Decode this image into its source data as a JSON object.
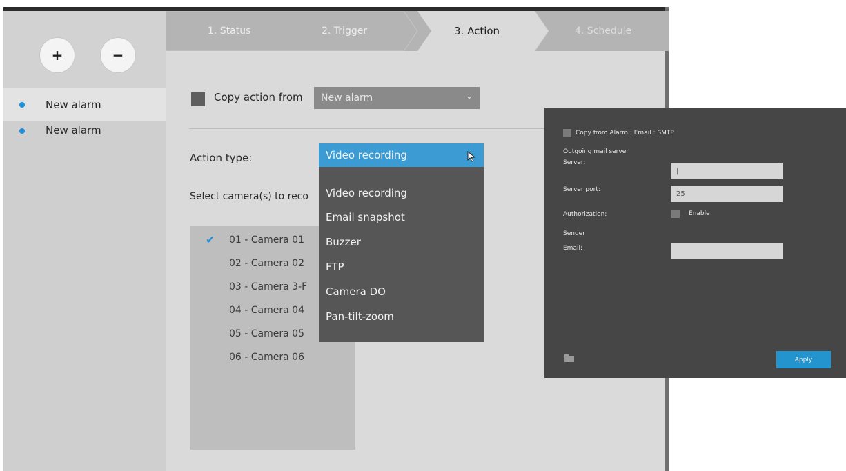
{
  "sidebar": {
    "add_label": "+",
    "remove_label": "−",
    "items": [
      {
        "label": "New alarm"
      },
      {
        "label": "New alarm"
      }
    ]
  },
  "steps": [
    {
      "label": "1. Status"
    },
    {
      "label": "2. Trigger"
    },
    {
      "label": "3. Action"
    },
    {
      "label": "4. Schedule"
    }
  ],
  "form": {
    "copy_label": "Copy action from",
    "copy_value": "New alarm",
    "action_type_label": "Action type:",
    "select_camera_label": "Select camera(s) to reco"
  },
  "dropdown": {
    "selected": "Video recording",
    "options": [
      {
        "label": "Video recording"
      },
      {
        "label": "Email snapshot"
      },
      {
        "label": "Buzzer"
      },
      {
        "label": "FTP"
      },
      {
        "label": "Camera DO"
      },
      {
        "label": "Pan-tilt-zoom"
      }
    ]
  },
  "cameras": [
    {
      "label": "01 - Camera 01"
    },
    {
      "label": "02 - Camera 02"
    },
    {
      "label": "03 - Camera 3-F"
    },
    {
      "label": "04 - Camera 04"
    },
    {
      "label": "05 - Camera 05"
    },
    {
      "label": "06 - Camera 06"
    }
  ],
  "email_panel": {
    "copy_label": "Copy from Alarm : Email : SMTP",
    "section_server": "Outgoing mail server",
    "server_label": "Server:",
    "server_value": "|",
    "port_label": "Server port:",
    "port_value": "25",
    "auth_label": "Authorization:",
    "auth_enable": "Enable",
    "section_sender": "Sender",
    "email_label": "Email:",
    "email_value": "",
    "apply_label": "Apply"
  },
  "colors": {
    "accent": "#1e8fd8",
    "dropdown_highlight": "#3b9bd2",
    "apply": "#2494cf"
  }
}
